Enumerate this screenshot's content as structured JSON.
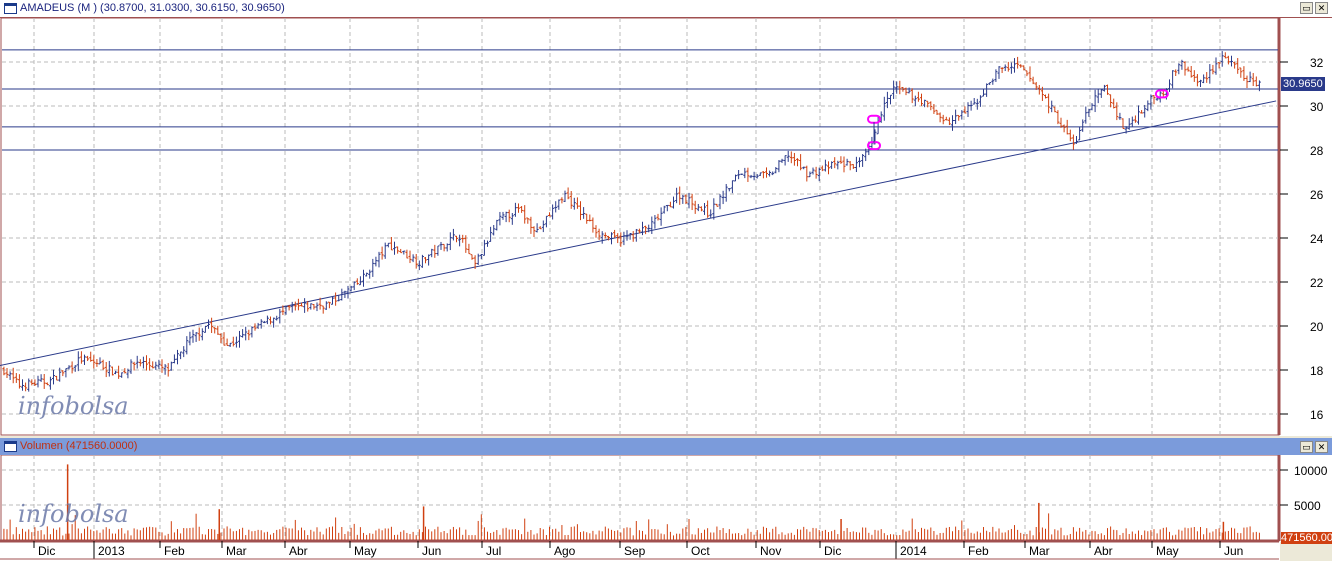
{
  "price_panel": {
    "title": "AMADEUS (M ) (30.8700, 31.0300, 30.6150, 30.9650)",
    "last_value": "30.9650"
  },
  "volume_panel": {
    "title": "Volumen (471560.0000)",
    "last_value": "471560.00"
  },
  "watermark": "infobolsa",
  "window_buttons": {
    "maximize": "▭",
    "close": "✕"
  },
  "colors": {
    "up": "#2a3a8a",
    "down": "#d04010",
    "lines": "#2a3a8a",
    "annotation": "#ff00ff",
    "volume": "#d04010"
  },
  "chart_data": [
    {
      "type": "ohlc",
      "title": "AMADEUS (M )",
      "ylim": [
        15,
        33.5
      ],
      "yticks": [
        "16",
        "18",
        "20",
        "22",
        "24",
        "26",
        "28",
        "30",
        "32"
      ],
      "grid": true,
      "x_labels": [
        "Dic",
        "2013",
        "Feb",
        "Mar",
        "Abr",
        "May",
        "Jun",
        "Jul",
        "Ago",
        "Sep",
        "Oct",
        "Nov",
        "Dic",
        "2014",
        "Feb",
        "Mar",
        "Abr",
        "May",
        "Jun"
      ],
      "approx_close": [
        [
          "2012-11-21",
          18.0
        ],
        [
          "2012-11-28",
          17.3
        ],
        [
          "2012-12-12",
          17.5
        ],
        [
          "2012-12-26",
          18.5
        ],
        [
          "2013-01-03",
          18.3
        ],
        [
          "2013-01-12",
          17.8
        ],
        [
          "2013-01-21",
          18.4
        ],
        [
          "2013-02-04",
          18.0
        ],
        [
          "2013-02-13",
          19.3
        ],
        [
          "2013-02-22",
          20.1
        ],
        [
          "2013-03-03",
          19.1
        ],
        [
          "2013-03-17",
          20.0
        ],
        [
          "2013-03-31",
          20.8
        ],
        [
          "2013-04-18",
          21.0
        ],
        [
          "2013-05-02",
          22.0
        ],
        [
          "2013-05-15",
          23.7
        ],
        [
          "2013-05-29",
          22.9
        ],
        [
          "2013-06-16",
          24.2
        ],
        [
          "2013-06-23",
          22.7
        ],
        [
          "2013-07-04",
          24.8
        ],
        [
          "2013-07-13",
          25.3
        ],
        [
          "2013-07-22",
          24.3
        ],
        [
          "2013-08-03",
          26.0
        ],
        [
          "2013-08-19",
          24.2
        ],
        [
          "2013-08-28",
          23.9
        ],
        [
          "2013-09-11",
          24.5
        ],
        [
          "2013-09-24",
          26.0
        ],
        [
          "2013-10-08",
          25.1
        ],
        [
          "2013-10-22",
          27.0
        ],
        [
          "2013-11-04",
          26.8
        ],
        [
          "2013-11-13",
          27.8
        ],
        [
          "2013-11-22",
          26.9
        ],
        [
          "2013-12-06",
          27.4
        ],
        [
          "2013-12-15",
          27.3
        ],
        [
          "2013-12-22",
          28.4
        ],
        [
          "2013-12-24",
          29.5
        ],
        [
          "2013-12-31",
          30.8
        ],
        [
          "2014-01-12",
          30.3
        ],
        [
          "2014-01-25",
          29.2
        ],
        [
          "2014-02-06",
          30.1
        ],
        [
          "2014-02-17",
          31.7
        ],
        [
          "2014-02-26",
          31.8
        ],
        [
          "2014-03-09",
          30.5
        ],
        [
          "2014-03-23",
          28.2
        ],
        [
          "2014-03-30",
          30.0
        ],
        [
          "2014-04-06",
          30.8
        ],
        [
          "2014-04-15",
          28.9
        ],
        [
          "2014-04-26",
          30.2
        ],
        [
          "2014-05-03",
          30.7
        ],
        [
          "2014-05-10",
          32.0
        ],
        [
          "2014-05-19",
          31.0
        ],
        [
          "2014-05-30",
          32.3
        ],
        [
          "2014-06-08",
          31.3
        ],
        [
          "2014-06-16",
          30.965
        ]
      ],
      "horizontal_lines": [
        32.55,
        30.77,
        29.05,
        28.0
      ],
      "trend_line": [
        [
          "2012-11-16",
          18.14
        ],
        [
          "2014-06-23",
          30.23
        ]
      ],
      "annotations": [
        [
          "2013-12-22",
          29.4
        ],
        [
          "2013-12-22",
          28.2
        ],
        [
          "2014-05-02",
          30.55
        ]
      ]
    },
    {
      "type": "bar",
      "title": "Volumen",
      "ylim": [
        0,
        12000
      ],
      "yticks": [
        "5000",
        "10000"
      ],
      "grid": true,
      "typical_volume": 1300,
      "spikes": [
        [
          "2012-12-20",
          10800
        ],
        [
          "2013-02-27",
          4400
        ],
        [
          "2013-05-31",
          4800
        ],
        [
          "2014-03-07",
          5300
        ],
        [
          "2013-12-07",
          3000
        ],
        [
          "2014-05-30",
          2600
        ]
      ]
    }
  ]
}
